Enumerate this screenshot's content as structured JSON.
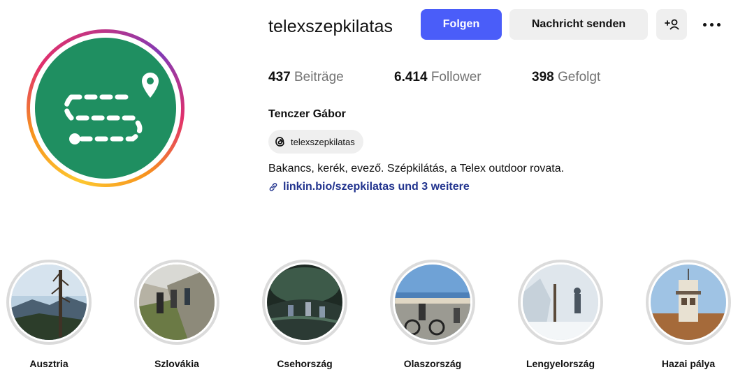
{
  "profile": {
    "username": "telexszepkilatas",
    "follow_label": "Folgen",
    "message_label": "Nachricht senden",
    "add_person_icon": "add-person-icon",
    "more_icon": "more-options-icon",
    "avatar_icon": "route-map-pin-logo",
    "accent_color": "#4a5df9",
    "avatar_color": "#1f8f61"
  },
  "stats": {
    "posts_count": "437",
    "posts_label": "Beiträge",
    "followers_count": "6.414",
    "followers_label": "Follower",
    "following_count": "398",
    "following_label": "Gefolgt"
  },
  "bio": {
    "full_name": "Tenczer Gábor",
    "threads_handle": "telexszepkilatas",
    "threads_icon": "threads-icon",
    "text": "Bakancs, kerék, evező. Szépkilátás, a Telex outdoor rovata.",
    "link_icon": "link-icon",
    "link_text": "linkin.bio/szepkilatas und 3 weitere"
  },
  "highlights": [
    {
      "label": "Ausztria"
    },
    {
      "label": "Szlovákia"
    },
    {
      "label": "Csehország"
    },
    {
      "label": "Olaszország"
    },
    {
      "label": "Lengyelország"
    },
    {
      "label": "Hazai pálya"
    }
  ]
}
